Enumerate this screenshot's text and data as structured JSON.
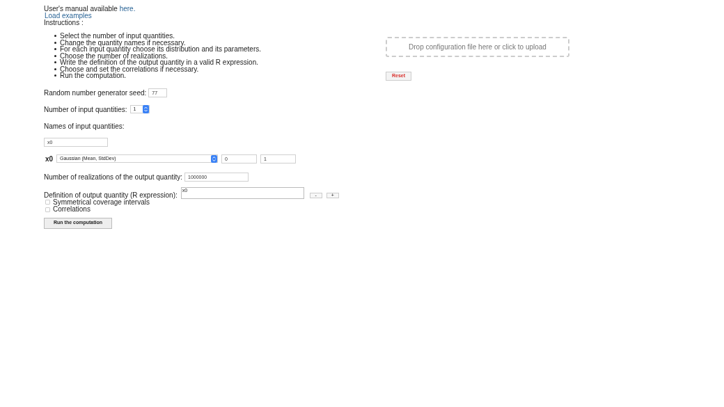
{
  "header": {
    "manual_text": "User's manual available",
    "manual_link": "here.",
    "examples_link": "Load examples",
    "instructions_label": "Instructions :"
  },
  "instructions": [
    "Select the number of input quantities.",
    "Change the quantity names if necessary.",
    "For each input quantity choose its distribution and its parameters.",
    "Choose the number of realizations.",
    "Write the definition of the output quantity in a valid R expression.",
    "Choose and set the correlations if necessary.",
    "Run the computation."
  ],
  "seed": {
    "label": "Random number generator seed:",
    "value": "77"
  },
  "num_inputs": {
    "label": "Number of input quantities:",
    "value": "1"
  },
  "names": {
    "label": "Names of input quantities:",
    "values": [
      "x0"
    ]
  },
  "quantities": [
    {
      "name": "x0",
      "distribution": "Gaussian (Mean, StdDev)",
      "params": [
        "0",
        "1"
      ]
    }
  ],
  "realizations": {
    "label": "Number of realizations of the output quantity:",
    "value": "1000000"
  },
  "definition": {
    "label": "Definition of output quantity (R expression):",
    "value": "x0",
    "buttons": [
      "-",
      "+"
    ]
  },
  "options": [
    {
      "label": "Symmetrical coverage intervals",
      "checked": false
    },
    {
      "label": "Correlations",
      "checked": false
    }
  ],
  "run_button": "Run the computation",
  "upload": {
    "text": "Drop configuration file here or click to upload"
  },
  "reset_button": "Reset"
}
